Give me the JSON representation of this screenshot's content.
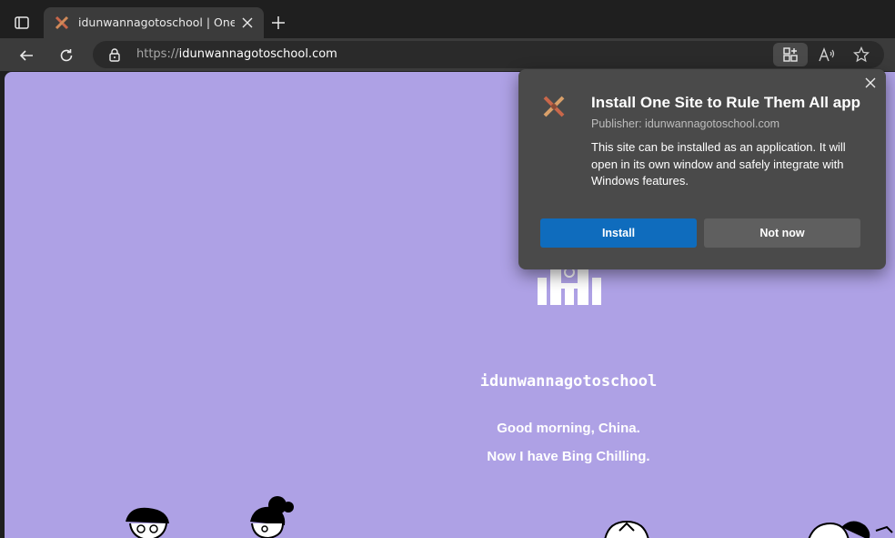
{
  "browser": {
    "tab": {
      "title": "idunwannagotoschool | One Site to Rule Them All"
    },
    "address": {
      "scheme": "https://",
      "domain": "idunwannagotoschool.com"
    }
  },
  "page": {
    "site_name": "idunwannagotoschool",
    "line1": "Good morning, China.",
    "line2": "Now I have Bing Chilling."
  },
  "install_popup": {
    "title": "Install One Site to Rule Them All app",
    "publisher": "Publisher: idunwannagotoschool.com",
    "description": "This site can be installed as an application. It will open in its own window and safely integrate with Windows features.",
    "install_label": "Install",
    "not_now_label": "Not now"
  },
  "colors": {
    "page_bg": "#aea1e5",
    "install_button": "#0f6cbd",
    "popup_bg": "#4a4a4a"
  },
  "icons": [
    "tab-actions-icon",
    "favicon-icon",
    "close-icon",
    "plus-icon",
    "back-icon",
    "refresh-icon",
    "lock-icon",
    "app-install-icon",
    "read-aloud-icon",
    "favorite-star-icon",
    "site-logo-icon"
  ]
}
